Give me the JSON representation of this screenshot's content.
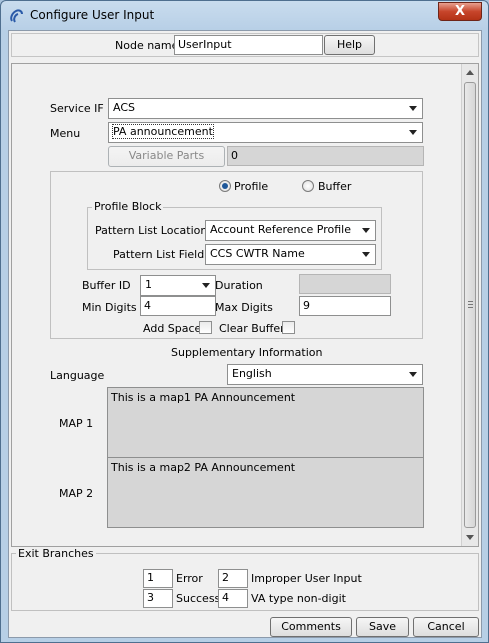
{
  "window": {
    "title": "Configure User Input",
    "close_label": "X"
  },
  "header": {
    "node_name_label": "Node name",
    "node_name_value": "UserInput",
    "help_label": "Help"
  },
  "form": {
    "service_if_label": "Service IF",
    "service_if_value": "ACS",
    "menu_label": "Menu",
    "menu_value": "PA announcement",
    "variable_parts_label": "Variable Parts",
    "variable_parts_value": "0",
    "source": {
      "profile_label": "Profile",
      "buffer_label": "Buffer",
      "selected": "profile"
    },
    "profile_block": {
      "title": "Profile Block",
      "pattern_list_location_label": "Pattern List Location",
      "pattern_list_location_value": "Account Reference Profile",
      "pattern_list_field_label": "Pattern List Field",
      "pattern_list_field_value": "CCS CWTR Name"
    },
    "buffer_id_label": "Buffer ID",
    "buffer_id_value": "1",
    "duration_label": "Duration",
    "duration_value": "",
    "min_digits_label": "Min Digits",
    "min_digits_value": "4",
    "max_digits_label": "Max Digits",
    "max_digits_value": "9",
    "add_space_label": "Add Space",
    "clear_buffer_label": "Clear Buffer",
    "supplementary_title": "Supplementary Information",
    "language_label": "Language",
    "language_value": "English",
    "map1_label": "MAP 1",
    "map1_value": "This is a map1 PA Announcement",
    "map2_label": "MAP 2",
    "map2_value": "This is a map2 PA Announcement"
  },
  "exit_branches": {
    "title": "Exit Branches",
    "items": [
      {
        "num": "1",
        "label": "Error"
      },
      {
        "num": "2",
        "label": "Improper User Input"
      },
      {
        "num": "3",
        "label": "Success"
      },
      {
        "num": "4",
        "label": "VA type non-digit"
      }
    ]
  },
  "footer": {
    "comments_label": "Comments",
    "save_label": "Save",
    "cancel_label": "Cancel"
  }
}
